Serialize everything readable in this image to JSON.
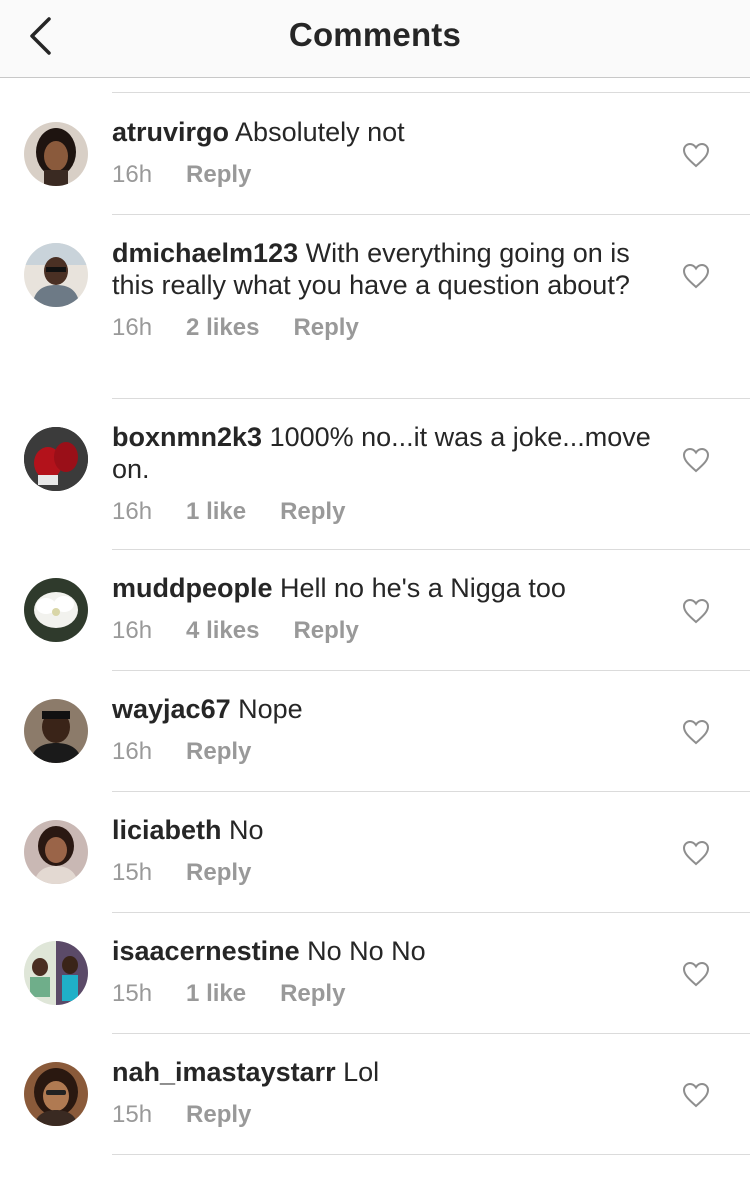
{
  "header": {
    "title": "Comments",
    "back_icon": "chevron-left-icon"
  },
  "colors": {
    "text": "#262626",
    "meta": "#999999",
    "divider": "#dbdbdb",
    "header_bg": "#fafafa"
  },
  "comments": [
    {
      "username": "atruvirgo",
      "text": "Absolutely not",
      "time": "16h",
      "likes": "",
      "reply": "Reply"
    },
    {
      "username": "dmichaelm123",
      "text": "With everything going on is this really what you have a question about?",
      "time": "16h",
      "likes": "2 likes",
      "reply": "Reply"
    },
    {
      "username": "boxnmn2k3",
      "text": "1000% no...it was a joke...move on.",
      "time": "16h",
      "likes": "1 like",
      "reply": "Reply"
    },
    {
      "username": "muddpeople",
      "text": "Hell no he's a Nigga too",
      "time": "16h",
      "likes": "4 likes",
      "reply": "Reply"
    },
    {
      "username": "wayjac67",
      "text": "Nope",
      "time": "16h",
      "likes": "",
      "reply": "Reply"
    },
    {
      "username": "liciabeth",
      "text": "No",
      "time": "15h",
      "likes": "",
      "reply": "Reply"
    },
    {
      "username": "isaacernestine",
      "text": "No No No",
      "time": "15h",
      "likes": "1 like",
      "reply": "Reply"
    },
    {
      "username": "nah_imastaystarr",
      "text": "Lol",
      "time": "15h",
      "likes": "",
      "reply": "Reply"
    }
  ]
}
